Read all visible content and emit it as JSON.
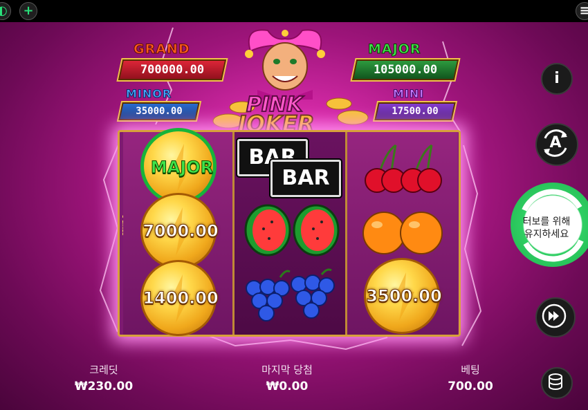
{
  "topbar": {
    "left_icon": "game-logo-icon",
    "plus_icon": "plus-icon",
    "right_icon": "menu-icon"
  },
  "jackpots": {
    "grand": {
      "title": "GRAND",
      "value": "700000.00"
    },
    "major": {
      "title": "MAJOR",
      "value": "105000.00"
    },
    "minor": {
      "title": "MINOR",
      "value": "35000.00"
    },
    "mini": {
      "title": "MINI",
      "value": "17500.00"
    }
  },
  "logo": {
    "line1": "PINK",
    "line2": "JOKER"
  },
  "reels": {
    "lines_label": "5 LINES",
    "reel1": [
      {
        "symbol": "jackpot-coin",
        "label": "MAJOR"
      },
      {
        "symbol": "coin",
        "label": "7000.00"
      },
      {
        "symbol": "coin",
        "label": "1400.00"
      }
    ],
    "reel2": [
      {
        "symbol": "bar",
        "label": "BAR"
      },
      {
        "symbol": "bar",
        "label": "BAR"
      },
      {
        "symbol": "watermelon",
        "label": ""
      },
      {
        "symbol": "grapes",
        "label": ""
      }
    ],
    "reel3": [
      {
        "symbol": "cherries",
        "label": ""
      },
      {
        "symbol": "oranges",
        "label": ""
      },
      {
        "symbol": "coin",
        "label": "3500.00"
      }
    ]
  },
  "controls": {
    "info_label": "i",
    "autoplay_label": "A",
    "turbo_label": "터보를 위해\n유지하세요",
    "fast_forward_icon": "fast-forward-icon",
    "coins_icon": "coin-stack-icon"
  },
  "bottom": {
    "credit_label": "크레딧",
    "credit_value": "₩230.00",
    "last_win_label": "마지막 당첨",
    "last_win_value": "₩0.00",
    "bet_label": "베팅",
    "bet_value": "700.00"
  },
  "colors": {
    "background": "#c2208f",
    "reel_frame": "#d7a13a",
    "turbo_green": "#2fcf63",
    "grand_title": "#ff5a1e",
    "major_title": "#3fe34a",
    "minor_title": "#4aa8ff",
    "mini_title": "#c77dff"
  }
}
